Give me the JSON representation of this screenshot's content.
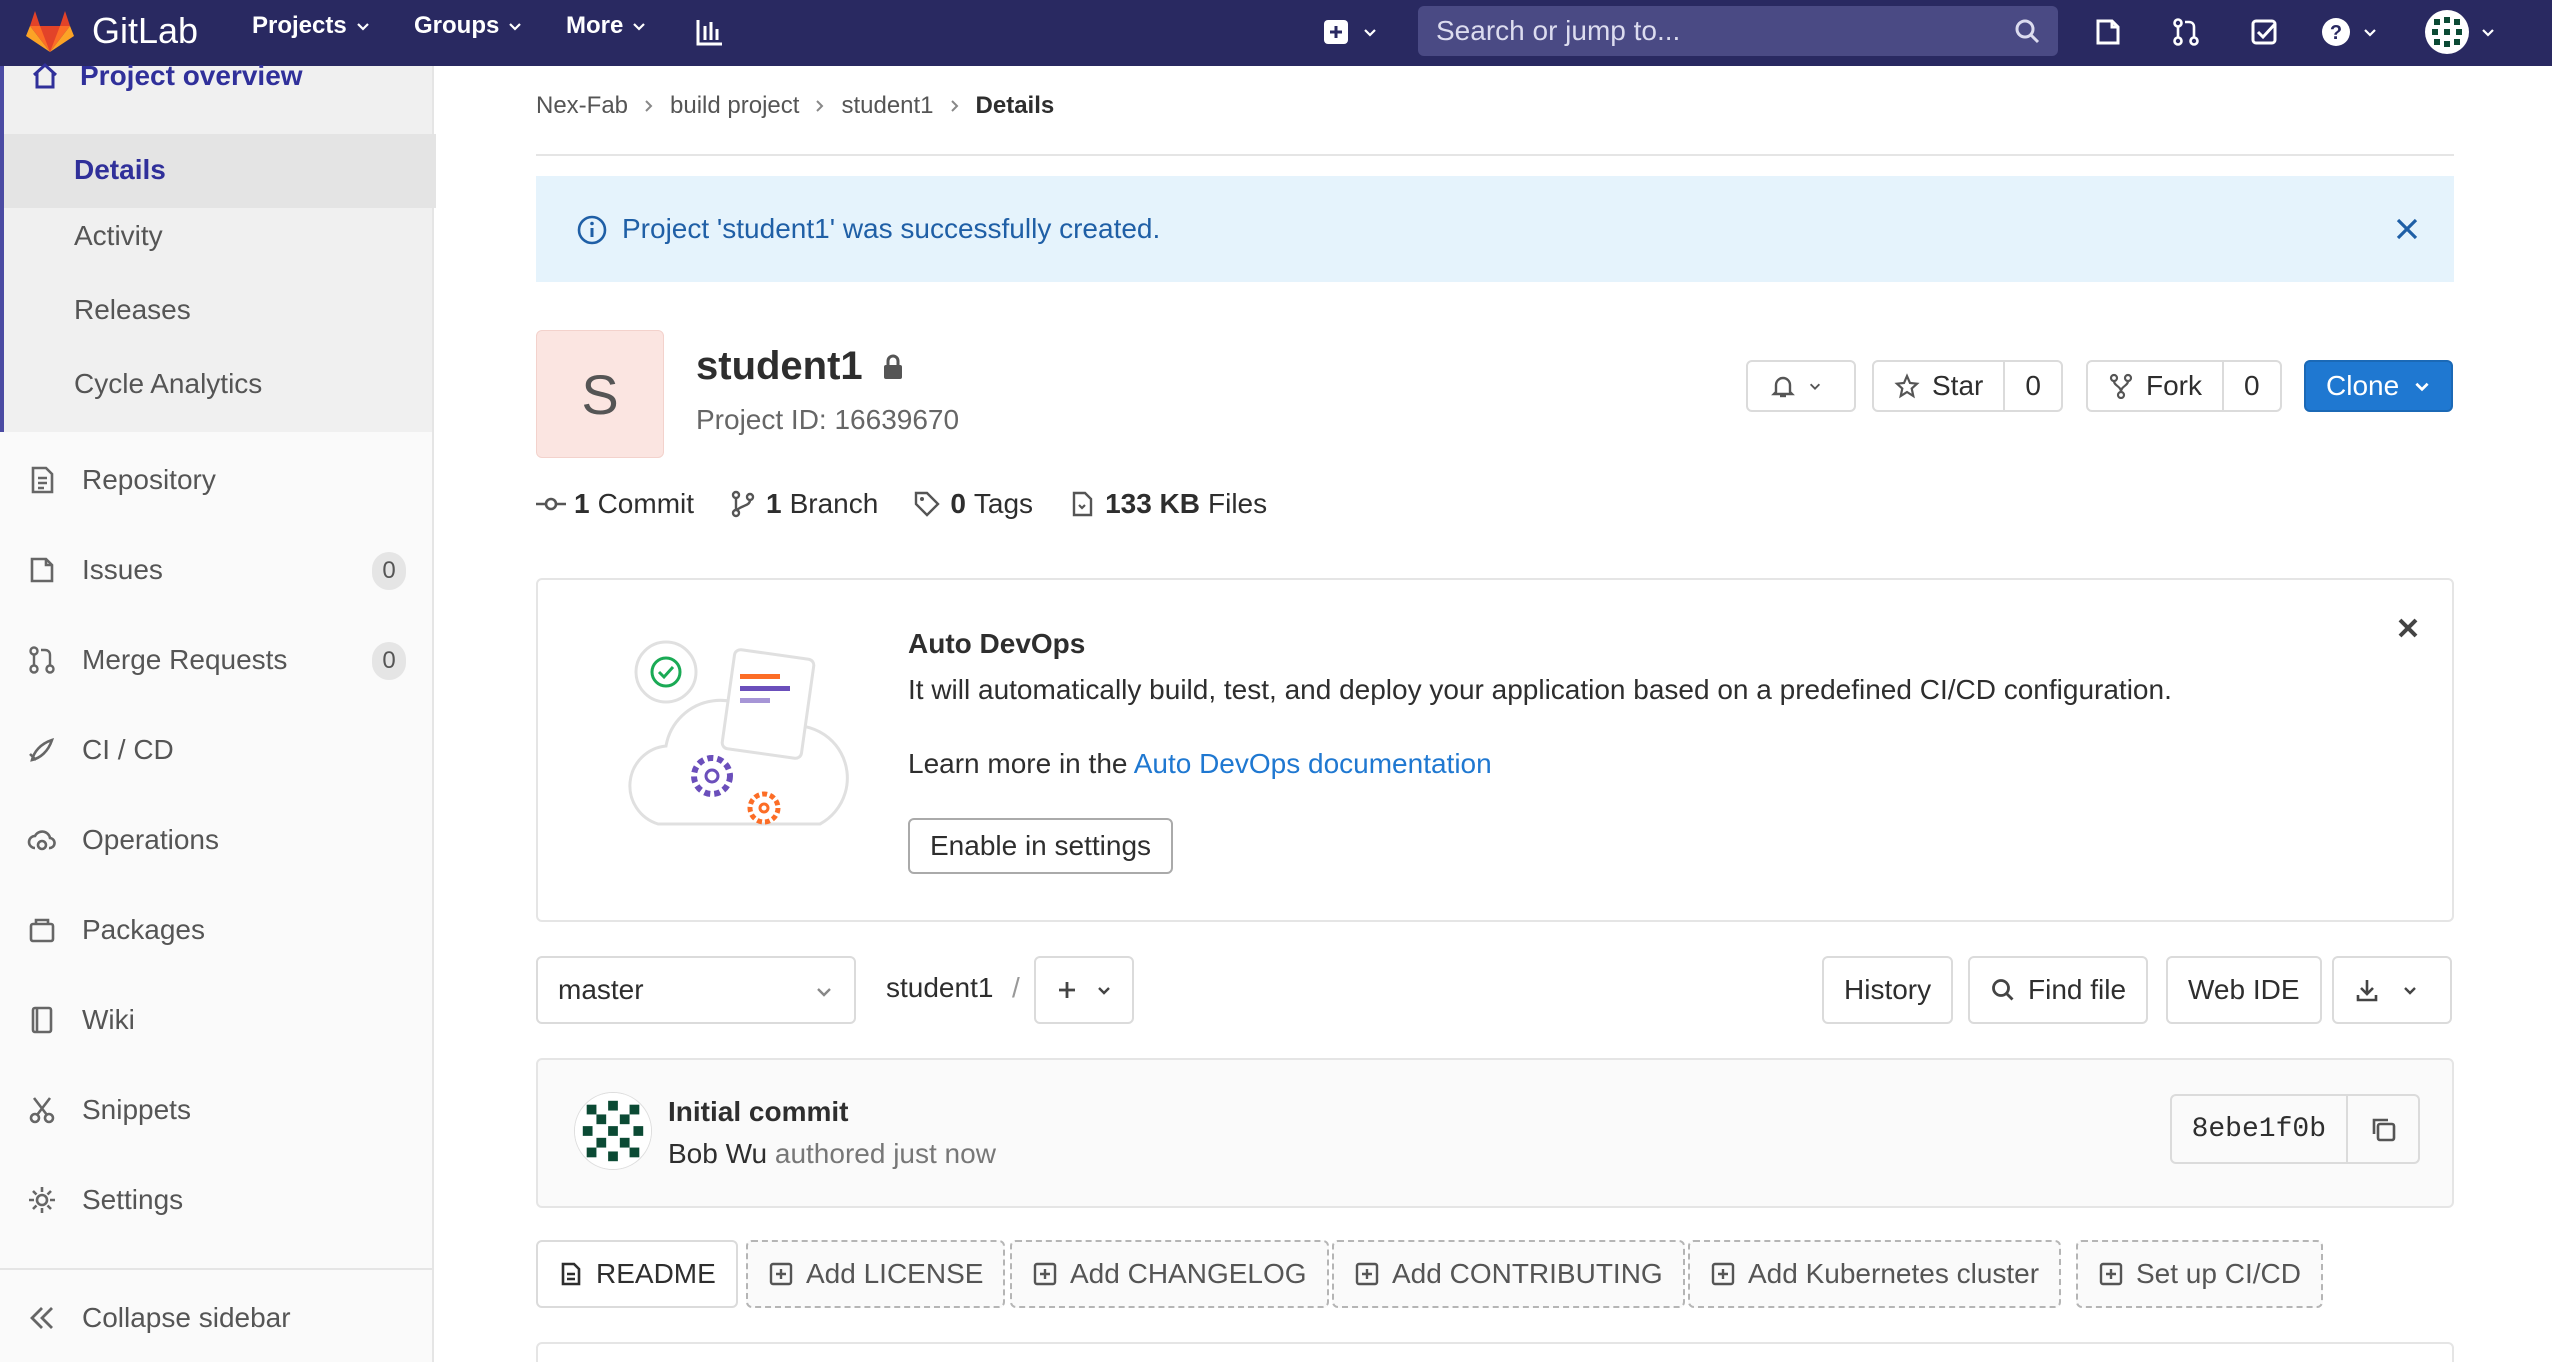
{
  "navbar": {
    "brand": "GitLab",
    "menus": [
      {
        "label": "Projects"
      },
      {
        "label": "Groups"
      },
      {
        "label": "More"
      }
    ],
    "search_placeholder": "Search or jump to..."
  },
  "sidebar": {
    "overview_label": "Project overview",
    "overview_sub": [
      {
        "label": "Details",
        "active": true
      },
      {
        "label": "Activity"
      },
      {
        "label": "Releases"
      },
      {
        "label": "Cycle Analytics"
      }
    ],
    "items": [
      {
        "label": "Repository",
        "icon": "repository-icon"
      },
      {
        "label": "Issues",
        "icon": "issues-icon",
        "count": "0"
      },
      {
        "label": "Merge Requests",
        "icon": "merge-request-icon",
        "count": "0"
      },
      {
        "label": "CI / CD",
        "icon": "rocket-icon"
      },
      {
        "label": "Operations",
        "icon": "cloud-gear-icon"
      },
      {
        "label": "Packages",
        "icon": "package-icon"
      },
      {
        "label": "Wiki",
        "icon": "book-icon"
      },
      {
        "label": "Snippets",
        "icon": "scissors-icon"
      },
      {
        "label": "Settings",
        "icon": "gear-icon"
      }
    ],
    "collapse_label": "Collapse sidebar"
  },
  "breadcrumb": {
    "items": [
      "Nex-Fab",
      "build project",
      "student1"
    ],
    "current": "Details"
  },
  "flash": {
    "message": "Project 'student1' was successfully created."
  },
  "project": {
    "avatar_letter": "S",
    "name": "student1",
    "id_text": "Project ID: 16639670",
    "star_label": "Star",
    "star_count": "0",
    "fork_label": "Fork",
    "fork_count": "0",
    "clone_label": "Clone"
  },
  "stats": {
    "commits_num": "1",
    "commits_label": "Commit",
    "branches_num": "1",
    "branches_label": "Branch",
    "tags_num": "0",
    "tags_label": "Tags",
    "files_num": "133 KB",
    "files_label": "Files"
  },
  "devops": {
    "title": "Auto DevOps",
    "description": "It will automatically build, test, and deploy your application based on a predefined CI/CD configuration.",
    "learn_prefix": "Learn more in the",
    "learn_link": "Auto DevOps documentation",
    "button_label": "Enable in settings"
  },
  "repo": {
    "branch": "master",
    "path": "student1",
    "path_sep": "/",
    "history_label": "History",
    "find_file_label": "Find file",
    "web_ide_label": "Web IDE"
  },
  "commit": {
    "title": "Initial commit",
    "author": "Bob Wu",
    "meta": "authored just now",
    "sha": "8ebe1f0b"
  },
  "quick_links": [
    {
      "label": "README",
      "style": "solid"
    },
    {
      "label": "Add LICENSE",
      "style": "dashed"
    },
    {
      "label": "Add CHANGELOG",
      "style": "dashed"
    },
    {
      "label": "Add CONTRIBUTING",
      "style": "dashed"
    },
    {
      "label": "Add Kubernetes cluster",
      "style": "dashed"
    },
    {
      "label": "Set up CI/CD",
      "style": "dashed"
    }
  ],
  "colors": {
    "navbar": "#292961",
    "accent": "#1f78d1",
    "sidebar_active": "#30309a",
    "flash_bg": "#e5f3fc"
  }
}
